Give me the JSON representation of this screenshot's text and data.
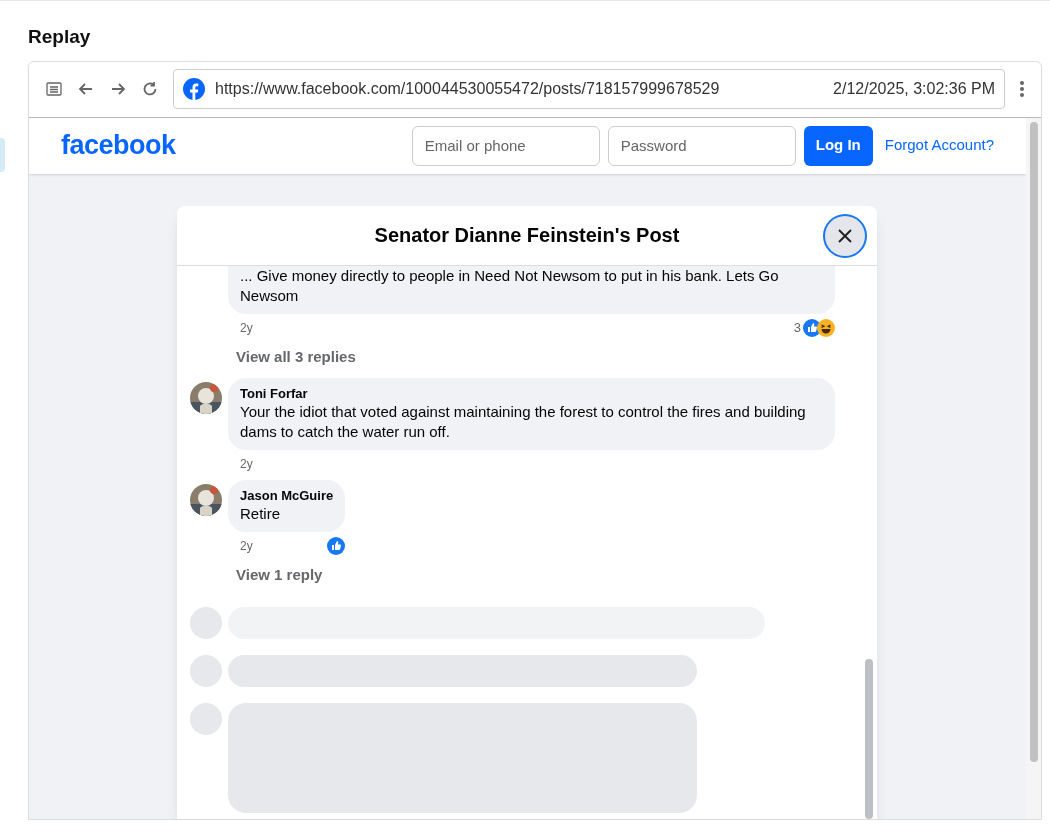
{
  "section_title": "Replay",
  "browser": {
    "url": "https://www.facebook.com/100044530055472/posts/718157999678529",
    "timestamp": "2/12/2025, 3:02:36 PM"
  },
  "facebook_header": {
    "logo": "facebook",
    "email_placeholder": "Email or phone",
    "password_placeholder": "Password",
    "login_button": "Log In",
    "forgot_link": "Forgot Account?"
  },
  "dialog": {
    "title": "Senator Dianne Feinstein's Post",
    "comments": [
      {
        "text": "... Give money directly to people in Need Not Newsom to put in his bank. Lets Go Newsom",
        "time": "2y",
        "reaction_count": "3",
        "reactions": [
          {
            "kind": "like"
          },
          {
            "kind": "haha"
          }
        ],
        "replies_link": "View all 3 replies"
      },
      {
        "author": "Toni Forfar",
        "avatar": {
          "kind": "picture"
        },
        "text": "Your the idiot that voted against maintaining the forest to control the fires and building dams to catch the water run off.",
        "time": "2y"
      },
      {
        "author": "Jason McGuire",
        "avatar": {
          "kind": "picture"
        },
        "text": "Retire",
        "time": "2y",
        "reactions": [
          {
            "kind": "like"
          }
        ],
        "replies_link": "View 1 reply"
      }
    ],
    "skeletons": [
      {
        "kind": "light"
      },
      {
        "kind": "short"
      },
      {
        "kind": "tall"
      }
    ]
  }
}
